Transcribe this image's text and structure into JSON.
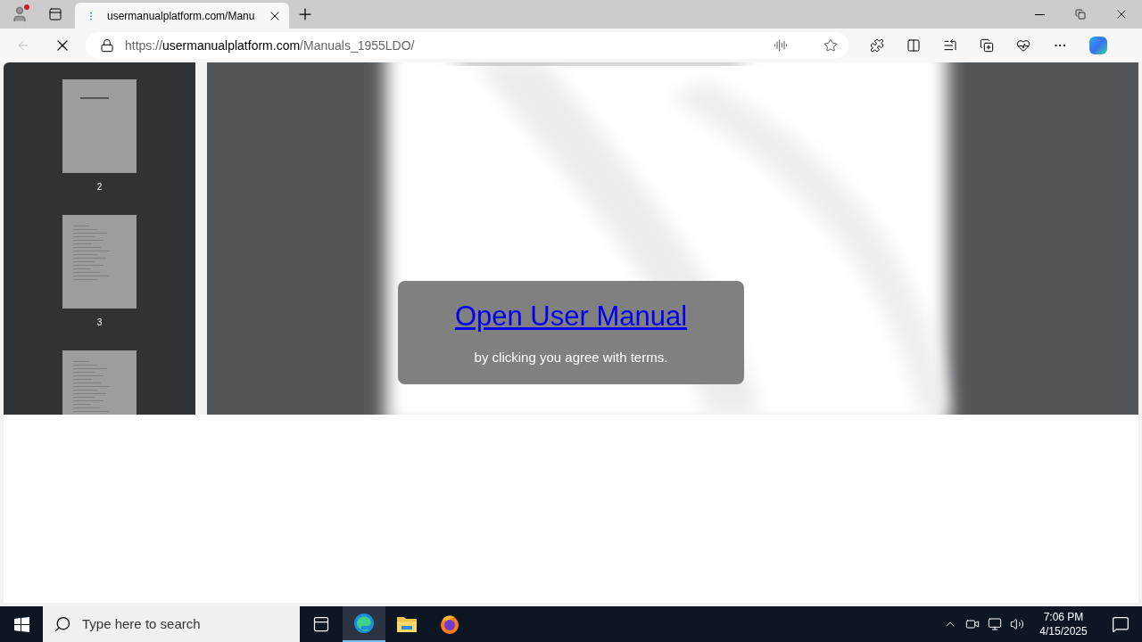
{
  "browser": {
    "tabs": [
      {
        "title": "usermanualplatform.com/Manu",
        "selected": true
      }
    ],
    "address": {
      "scheme": "https://",
      "host": "usermanualplatform.com",
      "path": "/Manuals_1955LDO/"
    }
  },
  "viewer": {
    "thumbnails": [
      {
        "label": "2",
        "kind": "cover"
      },
      {
        "label": "3",
        "kind": "contents"
      },
      {
        "kind": "contents"
      }
    ],
    "overlay": {
      "link": "Open User Manual",
      "note": "by clicking you agree with terms."
    }
  },
  "taskbar": {
    "search": {
      "placeholder": "Type here to search"
    },
    "apps": [
      {
        "kind": "edge",
        "selected": true
      },
      {
        "kind": "folder",
        "selected": false
      },
      {
        "kind": "firefox",
        "selected": false
      }
    ],
    "time": "7:06 PM",
    "date": "4/15/2025"
  }
}
